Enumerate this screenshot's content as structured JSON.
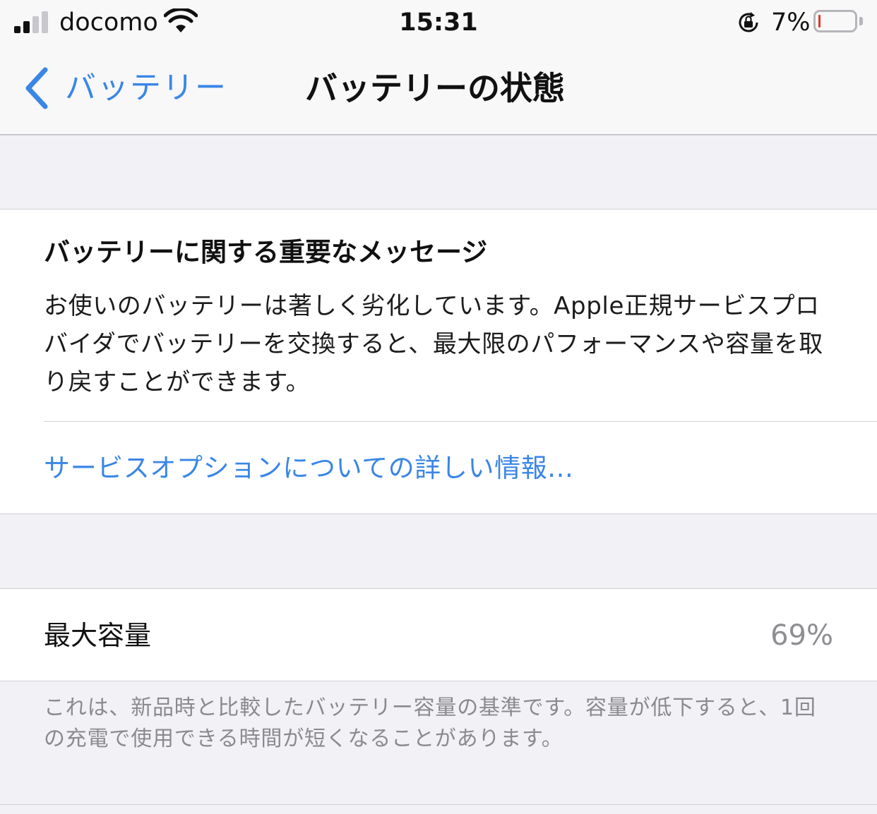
{
  "status_bar": {
    "carrier": "docomo",
    "time": "15:31",
    "battery_percent": "7%",
    "battery_level": 0.07,
    "signal_bars": 2,
    "icons": [
      "signal-icon",
      "wifi-icon",
      "rotation-lock-icon",
      "battery-icon"
    ]
  },
  "nav": {
    "back_label": "バッテリー",
    "title": "バッテリーの状態",
    "accent_color": "#3a86e6"
  },
  "message": {
    "title": "バッテリーに関する重要なメッセージ",
    "body": "お使いのバッテリーは著しく劣化しています。Apple正規サービスプロバイダでバッテリーを交換すると、最大限のパフォーマンスや容量を取り戻すことができます。",
    "link": "サービスオプションについての詳しい情報..."
  },
  "capacity": {
    "label": "最大容量",
    "value": "69%"
  },
  "footnote": "これは、新品時と比較したバッテリー容量の基準です。容量が低下すると、1回の充電で使用できる時間が短くなることがあります。"
}
